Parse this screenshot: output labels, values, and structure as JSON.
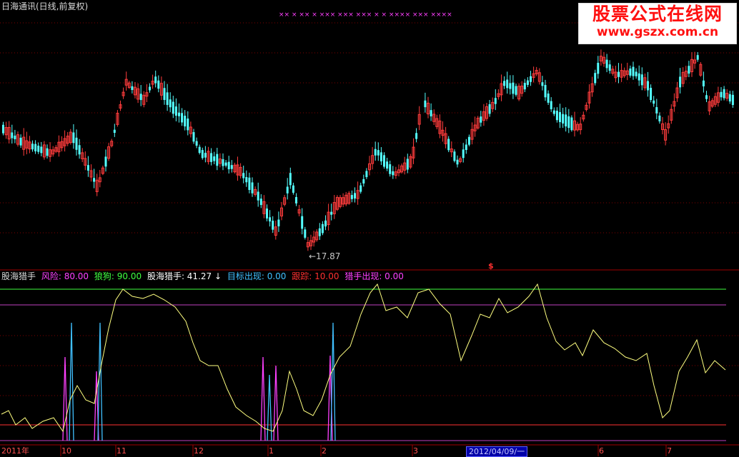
{
  "window": {
    "title": "日海通讯(日线,前复权)"
  },
  "watermark": {
    "title": "股票公式在线网",
    "url": "www.gszx.com.cn"
  },
  "price_panel": {
    "low_marker": "←17.87",
    "signal_mark": "$",
    "signal_row": "×× ×    ×× × ×××   ××× ×××  ×  × ××××  ×××  ××××"
  },
  "indicator_bar": {
    "name": "股海猎手",
    "items": [
      {
        "label": "风险: 80.00",
        "color": "#ff40ff"
      },
      {
        "label": "狼狗: 90.00",
        "color": "#40ff40"
      },
      {
        "label": "股海猎手: 41.27 ↓",
        "color": "#ffffff"
      },
      {
        "label": "目标出现: 0.00",
        "color": "#40c0ff"
      },
      {
        "label": "跟踪: 10.00",
        "color": "#ff3030"
      },
      {
        "label": "猎手出现: 0.00",
        "color": "#ff40ff"
      }
    ]
  },
  "time_axis": {
    "labels": [
      "2011年",
      "10",
      "11",
      "12",
      "1",
      "2",
      "3",
      "6",
      "7"
    ],
    "cursor_date": "2012/04/09/一"
  },
  "colors": {
    "up_candle": "#ff3c3c",
    "down_candle": "#54ffff",
    "indicator_line": "#ffff80",
    "risk_line": "#c040c0",
    "wolf_line": "#40ff40",
    "track_line": "#ff3030",
    "target_spike": "#40c0ff",
    "hunter_spike": "#ff40ff",
    "grid": "#800000"
  },
  "chart_data": {
    "type": "candlestick",
    "price_levels_low": 17.87,
    "indicator": {
      "risk": 80.0,
      "wolf": 90.0,
      "hunter": 41.27,
      "target": 0.0,
      "track": 10.0,
      "hunter_appear": 0.0
    }
  }
}
